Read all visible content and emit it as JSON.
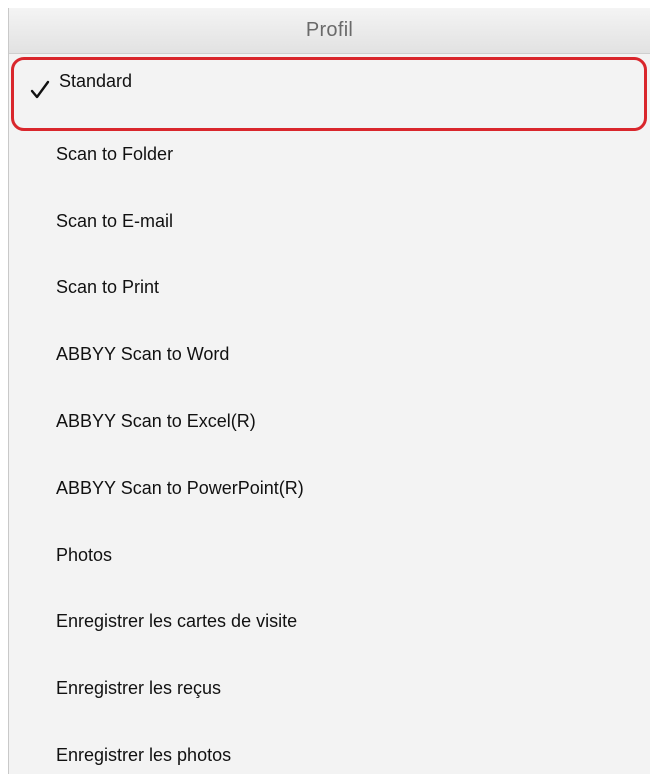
{
  "menu": {
    "title": "Profil",
    "selected_index": 0,
    "highlight_color": "#d9262c",
    "check_icon": "checkmark-icon",
    "items": [
      {
        "label": "Standard",
        "checked": true
      },
      {
        "label": "Scan to Folder",
        "checked": false
      },
      {
        "label": "Scan to E-mail",
        "checked": false
      },
      {
        "label": "Scan to Print",
        "checked": false
      },
      {
        "label": "ABBYY Scan to Word",
        "checked": false
      },
      {
        "label": "ABBYY Scan to Excel(R)",
        "checked": false
      },
      {
        "label": "ABBYY Scan to PowerPoint(R)",
        "checked": false
      },
      {
        "label": "Photos",
        "checked": false
      },
      {
        "label": "Enregistrer les cartes de visite",
        "checked": false
      },
      {
        "label": "Enregistrer les reçus",
        "checked": false
      },
      {
        "label": "Enregistrer les photos",
        "checked": false
      }
    ]
  }
}
